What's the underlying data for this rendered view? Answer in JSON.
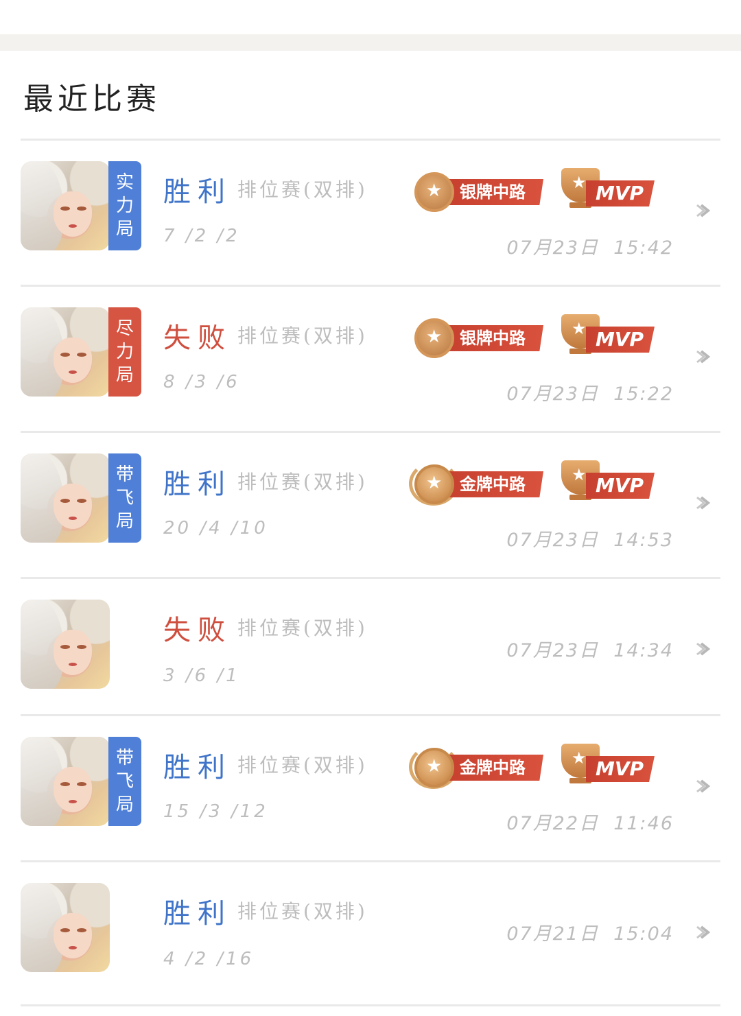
{
  "section": {
    "title": "最近比赛"
  },
  "matches": [
    {
      "tag": "实力局",
      "tag_color": "#4f7fd6",
      "result": "胜利",
      "result_type": "win",
      "mode": "排位赛(双排)",
      "kda": "7 /2 /2",
      "medal": "银牌中路",
      "medal_type": "silver",
      "mvp": "MVP",
      "time": "07月23日  15:42"
    },
    {
      "tag": "尽力局",
      "tag_color": "#d65442",
      "result": "失败",
      "result_type": "lose",
      "mode": "排位赛(双排)",
      "kda": "8 /3 /6",
      "medal": "银牌中路",
      "medal_type": "silver",
      "mvp": "MVP",
      "time": "07月23日  15:22"
    },
    {
      "tag": "带飞局",
      "tag_color": "#4f7fd6",
      "result": "胜利",
      "result_type": "win",
      "mode": "排位赛(双排)",
      "kda": "20 /4 /10",
      "medal": "金牌中路",
      "medal_type": "gold",
      "mvp": "MVP",
      "time": "07月23日  14:53"
    },
    {
      "tag": "",
      "tag_color": "",
      "result": "失败",
      "result_type": "lose",
      "mode": "排位赛(双排)",
      "kda": "3 /6 /1",
      "medal": "",
      "medal_type": "",
      "mvp": "",
      "time": "07月23日  14:34"
    },
    {
      "tag": "带飞局",
      "tag_color": "#4f7fd6",
      "result": "胜利",
      "result_type": "win",
      "mode": "排位赛(双排)",
      "kda": "15 /3 /12",
      "medal": "金牌中路",
      "medal_type": "gold",
      "mvp": "MVP",
      "time": "07月22日  11:46"
    },
    {
      "tag": "",
      "tag_color": "",
      "result": "胜利",
      "result_type": "win",
      "mode": "排位赛(双排)",
      "kda": "4 /2 /16",
      "medal": "",
      "medal_type": "",
      "mvp": "",
      "time": "07月21日  15:04"
    }
  ],
  "icons": {
    "hero_avatar": "hero-portrait",
    "chevron": "chevron-right-icon",
    "medal": "medal-star-icon",
    "mvp": "trophy-icon"
  }
}
